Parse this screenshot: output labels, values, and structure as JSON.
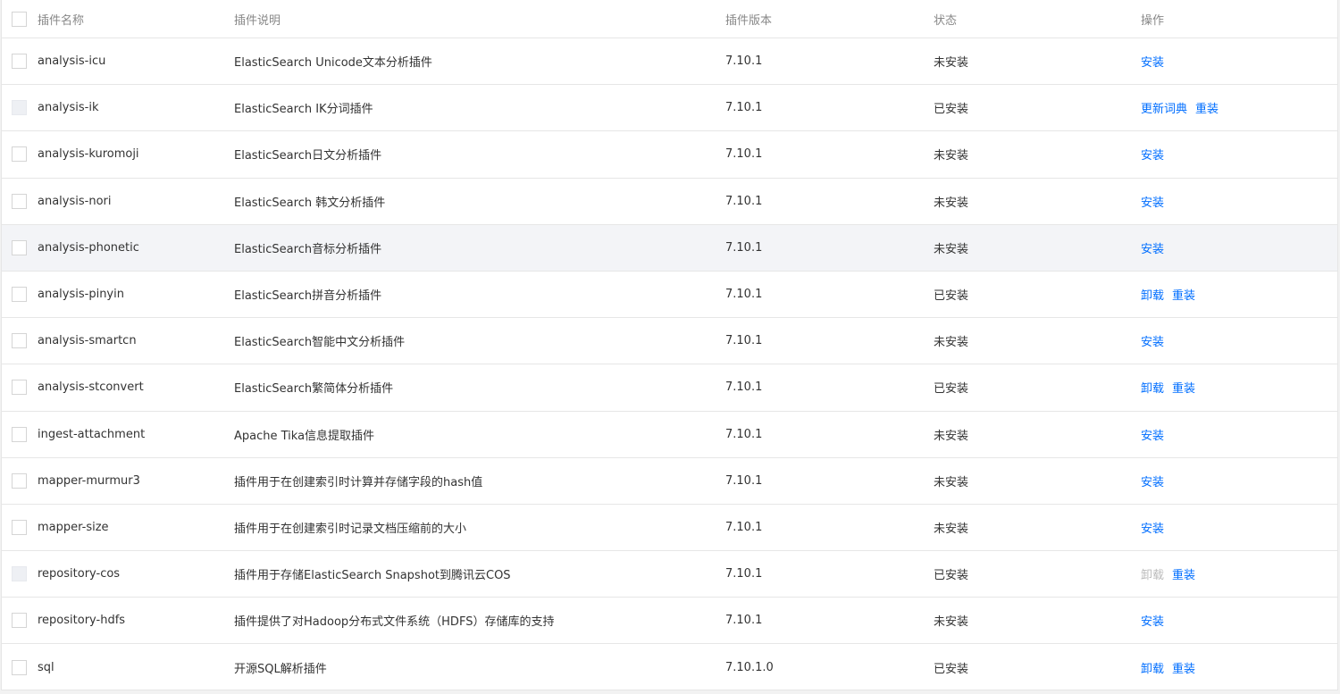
{
  "table": {
    "headers": {
      "name": "插件名称",
      "description": "插件说明",
      "version": "插件版本",
      "status": "状态",
      "operations": "操作"
    },
    "rows": [
      {
        "name": "analysis-icu",
        "description": "ElasticSearch Unicode文本分析插件",
        "version": "7.10.1",
        "status": "未安装",
        "checkbox_disabled": false,
        "ops": [
          {
            "label": "安装",
            "disabled": false
          }
        ]
      },
      {
        "name": "analysis-ik",
        "description": "ElasticSearch IK分词插件",
        "version": "7.10.1",
        "status": "已安装",
        "checkbox_disabled": true,
        "ops": [
          {
            "label": "更新词典",
            "disabled": false
          },
          {
            "label": "重装",
            "disabled": false
          }
        ]
      },
      {
        "name": "analysis-kuromoji",
        "description": "ElasticSearch日文分析插件",
        "version": "7.10.1",
        "status": "未安装",
        "checkbox_disabled": false,
        "ops": [
          {
            "label": "安装",
            "disabled": false
          }
        ]
      },
      {
        "name": "analysis-nori",
        "description": "ElasticSearch 韩文分析插件",
        "version": "7.10.1",
        "status": "未安装",
        "checkbox_disabled": false,
        "ops": [
          {
            "label": "安装",
            "disabled": false
          }
        ]
      },
      {
        "name": "analysis-phonetic",
        "description": "ElasticSearch音标分析插件",
        "version": "7.10.1",
        "status": "未安装",
        "checkbox_disabled": false,
        "hovered": true,
        "ops": [
          {
            "label": "安装",
            "disabled": false
          }
        ]
      },
      {
        "name": "analysis-pinyin",
        "description": "ElasticSearch拼音分析插件",
        "version": "7.10.1",
        "status": "已安装",
        "checkbox_disabled": false,
        "ops": [
          {
            "label": "卸载",
            "disabled": false
          },
          {
            "label": "重装",
            "disabled": false
          }
        ]
      },
      {
        "name": "analysis-smartcn",
        "description": "ElasticSearch智能中文分析插件",
        "version": "7.10.1",
        "status": "未安装",
        "checkbox_disabled": false,
        "ops": [
          {
            "label": "安装",
            "disabled": false
          }
        ]
      },
      {
        "name": "analysis-stconvert",
        "description": "ElasticSearch繁简体分析插件",
        "version": "7.10.1",
        "status": "已安装",
        "checkbox_disabled": false,
        "ops": [
          {
            "label": "卸载",
            "disabled": false
          },
          {
            "label": "重装",
            "disabled": false
          }
        ]
      },
      {
        "name": "ingest-attachment",
        "description": "Apache Tika信息提取插件",
        "version": "7.10.1",
        "status": "未安装",
        "checkbox_disabled": false,
        "ops": [
          {
            "label": "安装",
            "disabled": false
          }
        ]
      },
      {
        "name": "mapper-murmur3",
        "description": "插件用于在创建索引时计算并存储字段的hash值",
        "version": "7.10.1",
        "status": "未安装",
        "checkbox_disabled": false,
        "ops": [
          {
            "label": "安装",
            "disabled": false
          }
        ]
      },
      {
        "name": "mapper-size",
        "description": "插件用于在创建索引时记录文档压缩前的大小",
        "version": "7.10.1",
        "status": "未安装",
        "checkbox_disabled": false,
        "ops": [
          {
            "label": "安装",
            "disabled": false
          }
        ]
      },
      {
        "name": "repository-cos",
        "description": "插件用于存储ElasticSearch Snapshot到腾讯云COS",
        "version": "7.10.1",
        "status": "已安装",
        "checkbox_disabled": true,
        "ops": [
          {
            "label": "卸载",
            "disabled": true
          },
          {
            "label": "重装",
            "disabled": false
          }
        ]
      },
      {
        "name": "repository-hdfs",
        "description": "插件提供了对Hadoop分布式文件系统（HDFS）存储库的支持",
        "version": "7.10.1",
        "status": "未安装",
        "checkbox_disabled": false,
        "ops": [
          {
            "label": "安装",
            "disabled": false
          }
        ]
      },
      {
        "name": "sql",
        "description": "开源SQL解析插件",
        "version": "7.10.1.0",
        "status": "已安装",
        "checkbox_disabled": false,
        "ops": [
          {
            "label": "卸载",
            "disabled": false
          },
          {
            "label": "重装",
            "disabled": false
          }
        ]
      }
    ]
  },
  "colors": {
    "link": "#006eff",
    "link_disabled": "#bbbbbb",
    "header_text": "#888888",
    "text": "#333333",
    "border": "#e6e6e6",
    "hover_row": "#f3f4f7"
  }
}
